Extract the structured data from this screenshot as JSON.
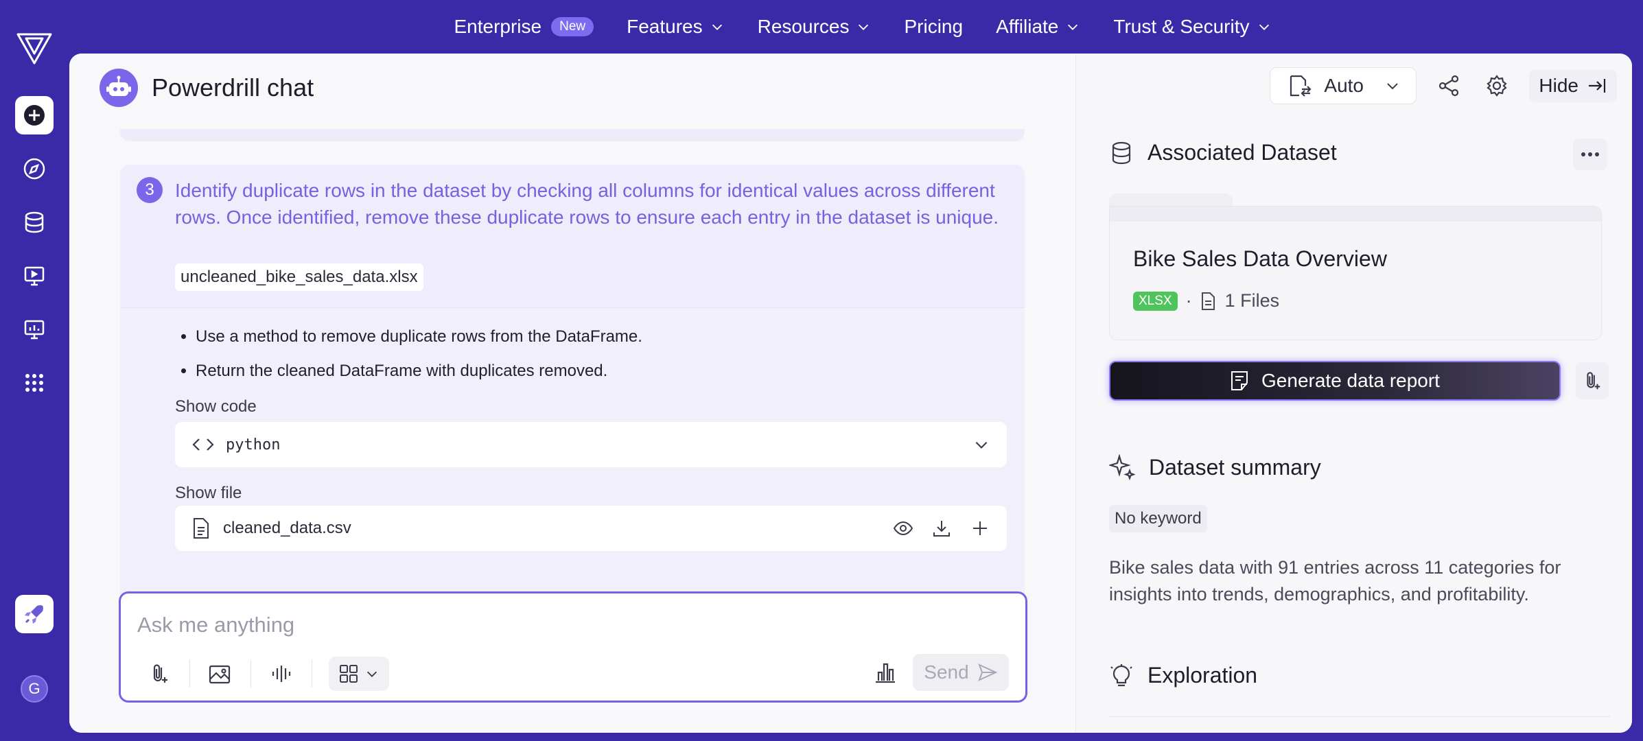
{
  "topnav": {
    "enterprise": "Enterprise",
    "enterprise_badge": "New",
    "features": "Features",
    "resources": "Resources",
    "pricing": "Pricing",
    "affiliate": "Affiliate",
    "trust": "Trust & Security"
  },
  "rail": {
    "avatar_letter": "G",
    "icons": [
      "add-icon",
      "compass-icon",
      "database-icon",
      "presentation-icon",
      "dashboard-icon",
      "apps-grid-icon",
      "rocket-icon"
    ]
  },
  "chat": {
    "title": "Powerdrill chat",
    "step": {
      "number": "3",
      "text": "Identify duplicate rows in the dataset by checking all columns for identical values across different rows. Once identified, remove these duplicate rows to ensure each entry in the dataset is unique.",
      "file": "uncleaned_bike_sales_data.xlsx",
      "bullets": [
        "Use a method to remove duplicate rows from the DataFrame.",
        "Return the cleaned DataFrame with duplicates removed."
      ],
      "show_code_label": "Show code",
      "code_lang": "python",
      "show_file_label": "Show file",
      "output_file": "cleaned_data.csv"
    },
    "composer": {
      "placeholder": "Ask me anything",
      "send_label": "Send"
    }
  },
  "side": {
    "mode": "Auto",
    "hide_label": "Hide",
    "associated_title": "Associated Dataset",
    "dataset": {
      "name": "Bike Sales Data Overview",
      "format": "XLSX",
      "files": "1 Files"
    },
    "generate_label": "Generate data report",
    "summary_title": "Dataset summary",
    "keyword": "No keyword",
    "summary_text": "Bike sales data with 91 entries across 11 categories for insights into trends, demographics, and profitability.",
    "exploration_title": "Exploration"
  },
  "colors": {
    "brand": "#3b2aa8",
    "accent": "#7a66e8",
    "xlsx_badge": "#4fc35c"
  }
}
